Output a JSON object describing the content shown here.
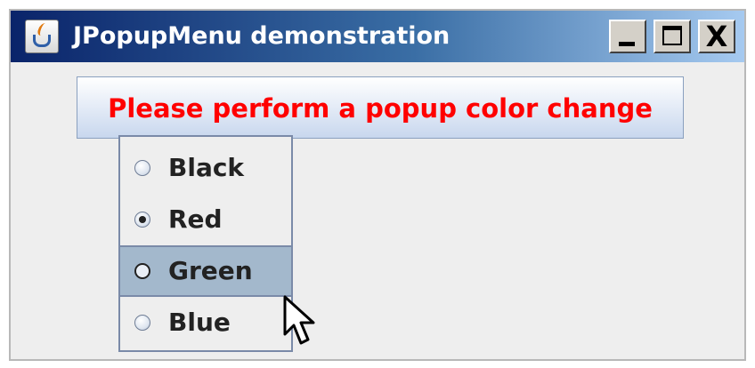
{
  "window": {
    "title": "JPopupMenu demonstration",
    "controls": {
      "minimize": "_",
      "maximize": "□",
      "close": "X"
    }
  },
  "label": {
    "text": "Please perform a popup color change",
    "color": "#ff0000"
  },
  "popup_menu": {
    "items": [
      {
        "label": "Black",
        "selected": false,
        "hovered": false
      },
      {
        "label": "Red",
        "selected": true,
        "hovered": false
      },
      {
        "label": "Green",
        "selected": false,
        "hovered": true
      },
      {
        "label": "Blue",
        "selected": false,
        "hovered": false
      }
    ]
  },
  "colors": {
    "title_gradient_start": "#0a246a",
    "title_gradient_end": "#a6caf0",
    "hover": "#a3b8cc"
  }
}
